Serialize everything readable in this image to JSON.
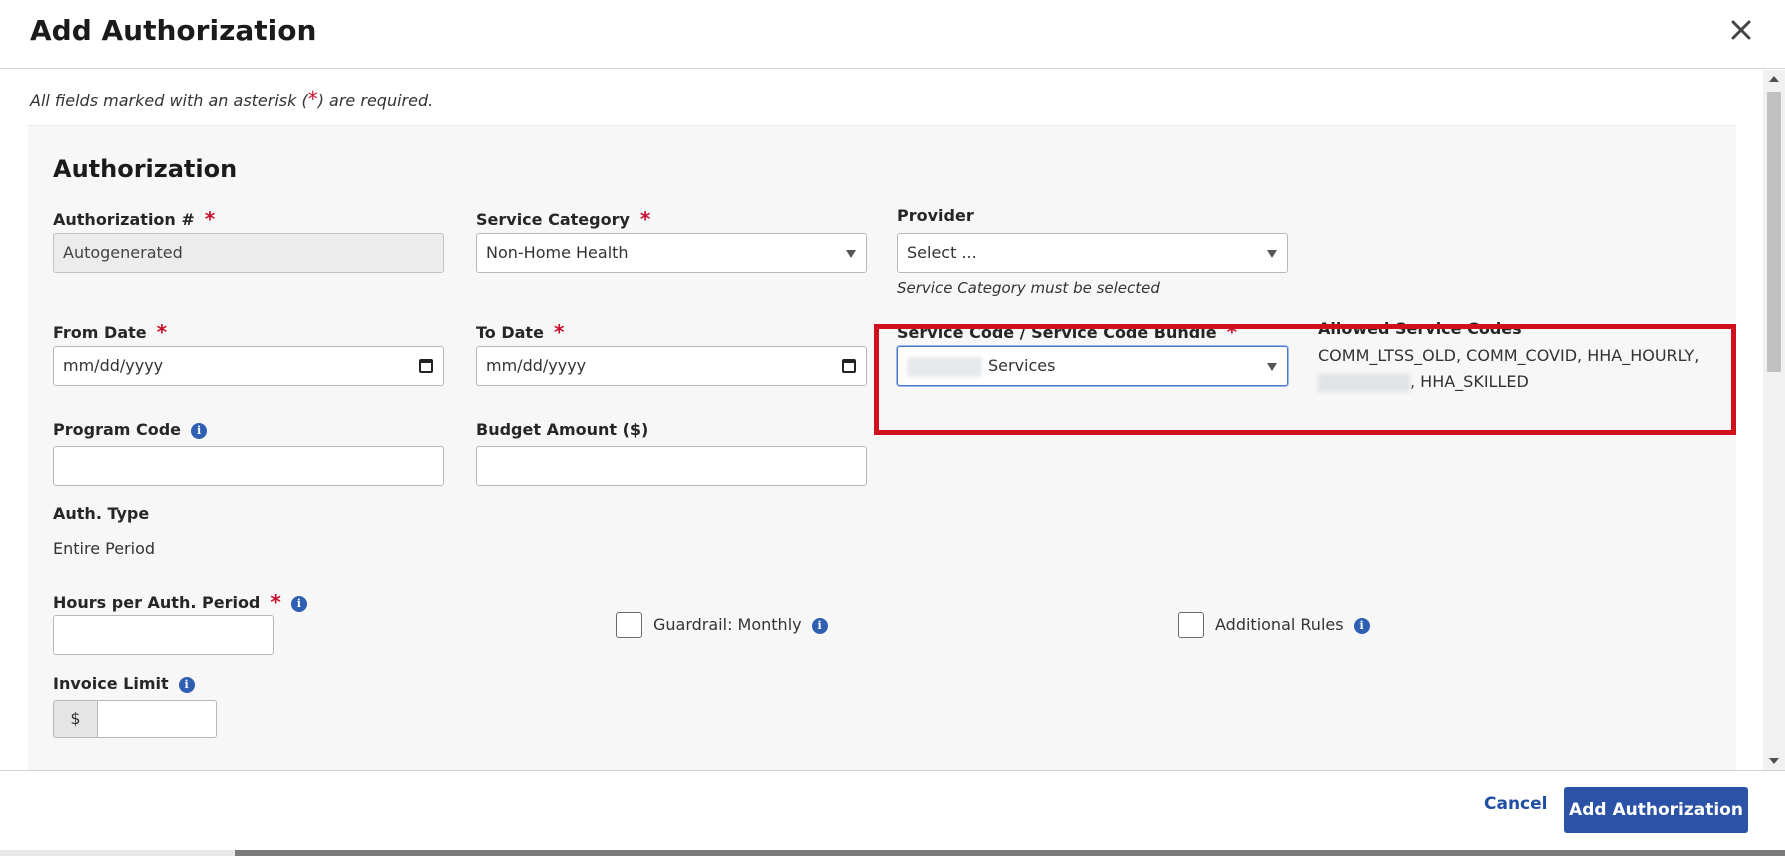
{
  "modal": {
    "title": "Add Authorization",
    "close_icon": "close-icon"
  },
  "note": {
    "prefix": "All fields marked with an asterisk (",
    "asterisk": "*",
    "suffix": ") are required."
  },
  "section": {
    "title": "Authorization"
  },
  "fields": {
    "auth_number": {
      "label": "Authorization #",
      "value": "Autogenerated",
      "required": "*"
    },
    "service_category": {
      "label": "Service Category",
      "value": "Non-Home Health",
      "required": "*"
    },
    "provider": {
      "label": "Provider",
      "value": "Select ...",
      "hint": "Service Category must be selected"
    },
    "from_date": {
      "label": "From Date",
      "placeholder": "mm/dd/yyyy",
      "required": "*"
    },
    "to_date": {
      "label": "To Date",
      "placeholder": "mm/dd/yyyy",
      "required": "*"
    },
    "service_code": {
      "label": "Service Code / Service Code Bundle",
      "value": "Services",
      "required": "*"
    },
    "allowed_codes": {
      "label": "Allowed Service Codes",
      "line1": "COMM_LTSS_OLD, COMM_COVID, HHA_HOURLY,",
      "line2_suffix": ", HHA_SKILLED"
    },
    "program_code": {
      "label": "Program Code",
      "value": ""
    },
    "budget_amount": {
      "label": "Budget Amount ($)",
      "value": ""
    },
    "auth_type": {
      "label": "Auth. Type",
      "value": "Entire Period"
    },
    "hours_per_period": {
      "label": "Hours per Auth. Period",
      "value": "",
      "required": "*"
    },
    "guardrail": {
      "label": "Guardrail: Monthly",
      "checked": false
    },
    "additional_rules": {
      "label": "Additional Rules",
      "checked": false
    },
    "invoice_limit": {
      "label": "Invoice Limit",
      "currency": "$",
      "value": ""
    }
  },
  "footer": {
    "cancel_label": "Cancel",
    "submit_label": "Add Authorization"
  },
  "colors": {
    "primary": "#2b52a6",
    "required": "#c8102e",
    "highlight": "#d0101c",
    "info": "#2e5fb3"
  }
}
